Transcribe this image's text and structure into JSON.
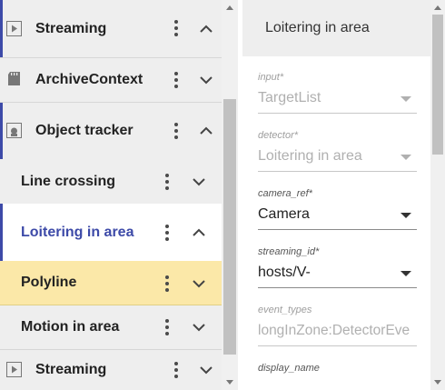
{
  "tree": {
    "items": [
      {
        "label": "Streaming",
        "icon": "stream-icon",
        "expanded": true,
        "level": "top"
      },
      {
        "label": "ArchiveContext",
        "icon": "sd-card-icon",
        "expanded": false,
        "level": "top"
      },
      {
        "label": "Object tracker",
        "icon": "tracker-icon",
        "expanded": true,
        "level": "top"
      },
      {
        "label": "Line crossing",
        "expanded": false,
        "level": "sub"
      },
      {
        "label": "Loitering in area",
        "expanded": true,
        "level": "sub",
        "selected": true
      },
      {
        "label": "Polyline",
        "expanded": false,
        "level": "sub",
        "highlighted": true
      },
      {
        "label": "Motion in area",
        "expanded": false,
        "level": "sub"
      },
      {
        "label": "Streaming",
        "icon": "stream-icon",
        "expanded": false,
        "level": "top"
      }
    ]
  },
  "detail": {
    "title": "Loitering in area",
    "fields": [
      {
        "label": "input",
        "required": "*",
        "value": "TargetList"
      },
      {
        "label": "detector",
        "required": "*",
        "value": "Loitering in area"
      },
      {
        "label": "camera_ref",
        "required": "*",
        "value": "Camera"
      },
      {
        "label": "streaming_id",
        "required": "*",
        "value": "hosts/V-"
      },
      {
        "label": "event_types",
        "required": "",
        "value": "longInZone:DetectorEve"
      },
      {
        "label": "display_name",
        "required": "",
        "value": ""
      }
    ]
  },
  "colors": {
    "accent": "#3d4aa8",
    "selected_text": "#3d4aa8",
    "highlight_bg": "#fbe8a8"
  }
}
